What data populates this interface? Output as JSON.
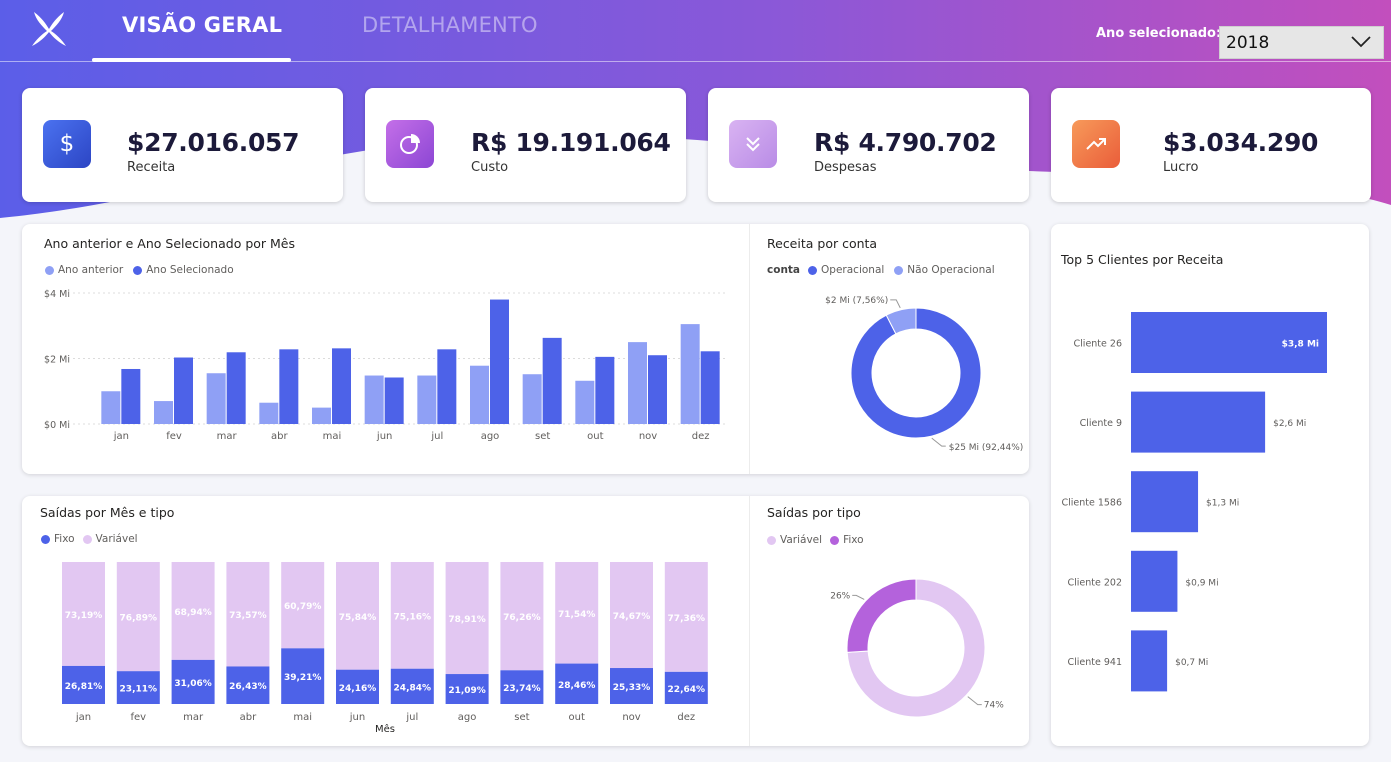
{
  "header": {
    "tabs": [
      {
        "label": "VISÃO GERAL",
        "active": true
      },
      {
        "label": "DETALHAMENTO",
        "active": false
      }
    ],
    "year_label": "Ano selecionado:",
    "year_value": "2018",
    "gradient": [
      "#5b5ce6",
      "#8d5ad6",
      "#c050bf"
    ]
  },
  "kpis": [
    {
      "value": "$27.016.057",
      "label": "Receita",
      "icon": "dollar-icon",
      "color": "#3b5fd9"
    },
    {
      "value": "R$ 19.191.064",
      "label": "Custo",
      "icon": "pie-chart-icon",
      "color": "#a45ad9"
    },
    {
      "value": "R$ 4.790.702",
      "label": "Despesas",
      "icon": "chevrons-down-icon",
      "color": "#c99bea"
    },
    {
      "value": "$3.034.290",
      "label": "Lucro",
      "icon": "trending-up-icon",
      "color": "#f07d46"
    }
  ],
  "panels": {
    "monthly": {
      "title": "Ano anterior e Ano Selecionado por Mês",
      "legend": [
        "Ano anterior",
        "Ano Selecionado"
      ]
    },
    "receita_conta": {
      "title": "Receita por conta",
      "legend_title": "conta",
      "legend": [
        "Operacional",
        "Não Operacional"
      ]
    },
    "top_clients": {
      "title": "Top 5 Clientes por Receita"
    },
    "saidas_mes": {
      "title": "Saídas por Mês e tipo",
      "legend": [
        "Fixo",
        "Variável"
      ],
      "xlabel": "Mês"
    },
    "saidas_tipo": {
      "title": "Saídas por tipo",
      "legend": [
        "Variável",
        "Fixo"
      ]
    }
  },
  "chart_data": [
    {
      "id": "monthly",
      "type": "bar",
      "title": "Ano anterior e Ano Selecionado por Mês",
      "categories": [
        "jan",
        "fev",
        "mar",
        "abr",
        "mai",
        "jun",
        "jul",
        "ago",
        "set",
        "out",
        "nov",
        "dez"
      ],
      "series": [
        {
          "name": "Ano anterior",
          "color": "#8fa0f5",
          "values": [
            1.0,
            0.7,
            1.55,
            0.65,
            0.5,
            1.48,
            1.48,
            1.78,
            1.52,
            1.32,
            2.5,
            3.05
          ]
        },
        {
          "name": "Ano Selecionado",
          "color": "#4d62e8",
          "values": [
            1.68,
            2.03,
            2.19,
            2.28,
            2.31,
            1.42,
            2.28,
            3.8,
            2.63,
            2.05,
            2.1,
            2.22
          ]
        }
      ],
      "ylim": [
        0,
        4
      ],
      "yticks": [
        "$0 Mi",
        "$2 Mi",
        "$4 Mi"
      ],
      "grid": true
    },
    {
      "id": "receita_conta",
      "type": "pie",
      "title": "Receita por conta",
      "donut": true,
      "slices": [
        {
          "name": "Operacional",
          "value": 92.44,
          "label": "$25 Mi (92,44%)",
          "color": "#4d62e8"
        },
        {
          "name": "Não Operacional",
          "value": 7.56,
          "label": "$2 Mi (7,56%)",
          "color": "#8fa0f5"
        }
      ]
    },
    {
      "id": "top_clients",
      "type": "bar",
      "orientation": "horizontal",
      "title": "Top 5 Clientes por Receita",
      "categories": [
        "Cliente 26",
        "Cliente 9",
        "Cliente 1586",
        "Cliente 202",
        "Cliente 941"
      ],
      "values": [
        3.8,
        2.6,
        1.3,
        0.9,
        0.7
      ],
      "labels": [
        "$3,8 Mi",
        "$2,6 Mi",
        "$1,3 Mi",
        "$0,9 Mi",
        "$0,7 Mi"
      ],
      "color": "#4d62e8"
    },
    {
      "id": "saidas_mes",
      "type": "bar",
      "stacked": "100%",
      "title": "Saídas por Mês e tipo",
      "xlabel": "Mês",
      "categories": [
        "jan",
        "fev",
        "mar",
        "abr",
        "mai",
        "jun",
        "jul",
        "ago",
        "set",
        "out",
        "nov",
        "dez"
      ],
      "series": [
        {
          "name": "Fixo",
          "color": "#4d62e8",
          "values": [
            26.81,
            23.11,
            31.06,
            26.43,
            39.21,
            24.16,
            24.84,
            21.09,
            23.74,
            28.46,
            25.33,
            22.64
          ],
          "labels": [
            "26,81%",
            "23,11%",
            "31,06%",
            "26,43%",
            "39,21%",
            "24,16%",
            "24,84%",
            "21,09%",
            "23,74%",
            "28,46%",
            "25,33%",
            "22,64%"
          ]
        },
        {
          "name": "Variável",
          "color": "#e2c7f2",
          "values": [
            73.19,
            76.89,
            68.94,
            73.57,
            60.79,
            75.84,
            75.16,
            78.91,
            76.26,
            71.54,
            74.67,
            77.36
          ],
          "labels": [
            "73,19%",
            "76,89%",
            "68,94%",
            "73,57%",
            "60,79%",
            "75,84%",
            "75,16%",
            "78,91%",
            "76,26%",
            "71,54%",
            "74,67%",
            "77,36%"
          ]
        }
      ]
    },
    {
      "id": "saidas_tipo",
      "type": "pie",
      "title": "Saídas por tipo",
      "donut": true,
      "slices": [
        {
          "name": "Variável",
          "value": 74,
          "label": "74%",
          "color": "#e2c7f2"
        },
        {
          "name": "Fixo",
          "value": 26,
          "label": "26%",
          "color": "#b462dc"
        }
      ]
    }
  ]
}
